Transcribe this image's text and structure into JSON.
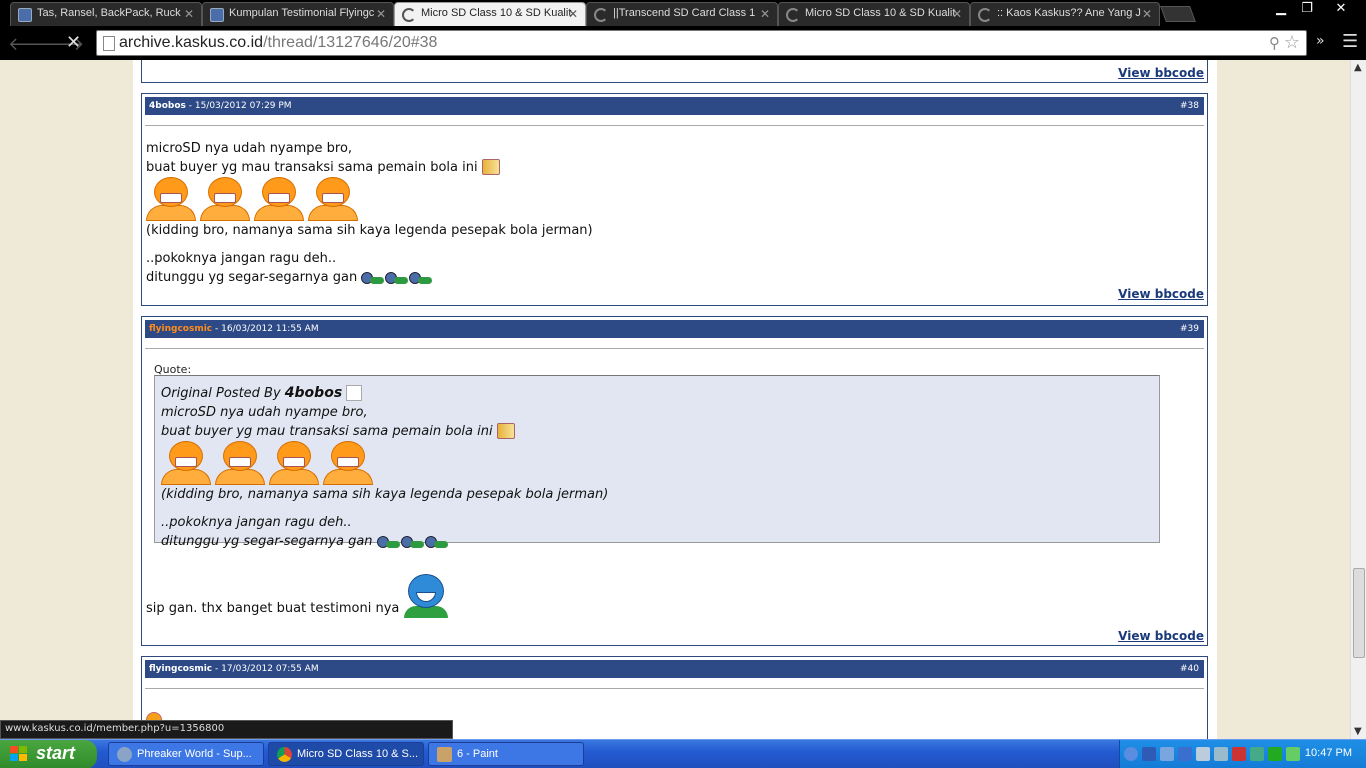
{
  "browser": {
    "tabs": [
      {
        "title": "Tas, Ransel, BackPack, Ruck",
        "state": "inactive"
      },
      {
        "title": "Kumpulan Testimonial Flyingc",
        "state": "inactive"
      },
      {
        "title": "Micro SD Class 10 & SD Kualit",
        "state": "active"
      },
      {
        "title": "||Transcend SD Card Class 1",
        "state": "loading"
      },
      {
        "title": "Micro SD Class 10 & SD Kualit",
        "state": "loading"
      },
      {
        "title": ":: Kaos Kaskus?? Ane Yang J",
        "state": "loading"
      }
    ],
    "url_host": "archive.kaskus.co.id",
    "url_path": "/thread/13127646/20#38",
    "status_url": "www.kaskus.co.id/member.php?u=1356800"
  },
  "posts": [
    {
      "user": "4bobos",
      "date": " - 15/03/2012 07:29 PM",
      "number": "#38",
      "lines": [
        "microSD nya udah nyampe bro,",
        "buat buyer yg mau transaksi sama pemain bola ini",
        "(kidding bro, namanya sama sih kaya legenda pesepak bola jerman)",
        "..pokoknya jangan ragu deh..",
        "ditunggu yg segar-segarnya gan"
      ],
      "bbcode": "View bbcode"
    },
    {
      "user": "flyingcosmic",
      "date": " - 16/03/2012 11:55 AM",
      "number": "#39",
      "quote_label": "Quote:",
      "quote_prefix": "Original Posted By ",
      "quote_author": "4bobos",
      "quote_lines": [
        "microSD nya udah nyampe bro,",
        "buat buyer yg mau transaksi sama pemain bola ini",
        "(kidding bro, namanya sama sih kaya legenda pesepak bola jerman)",
        "..pokoknya jangan ragu deh..",
        "ditunggu yg segar-segarnya gan"
      ],
      "reply": "sip gan. thx banget buat testimoni nya",
      "bbcode": "View bbcode"
    },
    {
      "user": "flyingcosmic",
      "date": " - 17/03/2012 07:55 AM",
      "number": "#40"
    }
  ],
  "top_bbcode": "View bbcode",
  "taskbar": {
    "start_label": "start",
    "items": [
      {
        "label": "Phreaker World - Sup..."
      },
      {
        "label": "Micro SD Class 10 & S..."
      },
      {
        "label": "6 - Paint"
      }
    ],
    "clock": "10:47 PM"
  },
  "colors": {
    "post_header": "#2d4a86",
    "username_orange": "#ff8c1a",
    "page_bg": "#efead7",
    "taskbar_blue": "#245bd1",
    "start_green": "#2f8a2a"
  }
}
